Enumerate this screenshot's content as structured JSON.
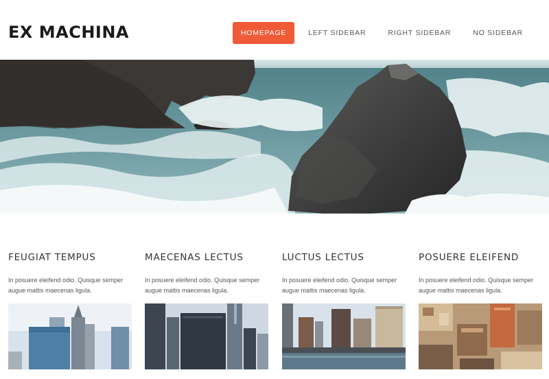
{
  "header": {
    "logo": "EX MACHINA",
    "nav": [
      {
        "label": "HOMEPAGE",
        "active": true
      },
      {
        "label": "LEFT SIDEBAR",
        "active": false
      },
      {
        "label": "RIGHT SIDEBAR",
        "active": false
      },
      {
        "label": "NO SIDEBAR",
        "active": false
      }
    ]
  },
  "colors": {
    "accent": "#f05a36",
    "sea": "#5f8f98",
    "foam": "#e8f1f2"
  },
  "features": [
    {
      "title": "FEUGIAT TEMPUS",
      "text": "In posuere eleifend odio. Quisque semper augue mattis maecenas ligula."
    },
    {
      "title": "MAECENAS LECTUS",
      "text": "In posuere eleifend odio. Quisque semper augue mattis maecenas ligula."
    },
    {
      "title": "LUCTUS LECTUS",
      "text": "In posuere eleifend odio. Quisque semper augue mattis maecenas ligula."
    },
    {
      "title": "POSUERE ELEIFEND",
      "text": "In posuere eleifend odio. Quisque semper augue mattis maecenas ligula."
    }
  ]
}
